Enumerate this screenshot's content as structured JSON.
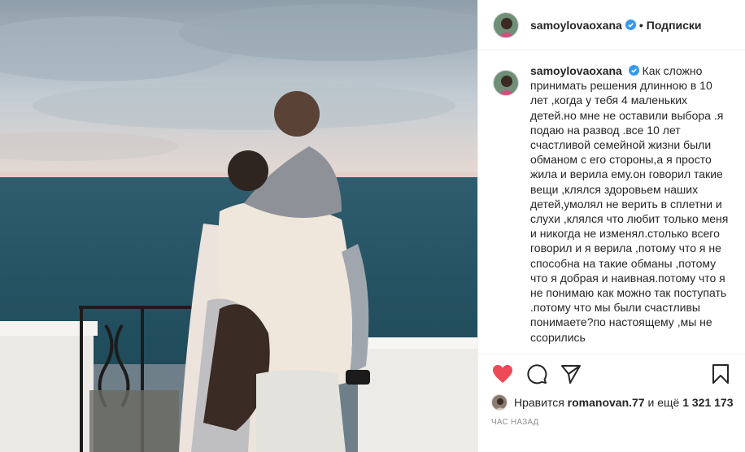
{
  "post": {
    "username": "samoylovaoxana",
    "separator": "•",
    "follow_label": "Подписки",
    "caption_text": "Как сложно принимать решения длинною в 10 лет ,когда у тебя 4 маленьких детей.но мне не оставили выбора .я подаю на развод .все 10 лет счастливой семейной жизни были обманом с его стороны,а я просто жила и верила ему.он говорил такие вещи ,клялся здоровьем наших детей,умолял не верить в сплетни и слухи ,клялся что любит только меня и никогда не изменял.столько всего говорил и я верила ,потому что я не способна на такие обманы ,потому что я добрая и наивная.потому что я не понимаю как можно так поступать .потому что мы были счастливы понимаете?по настоящему ,мы не ссорились",
    "likes_prefix": "Нравится",
    "likes_user": "romanovan.77",
    "likes_middle": "и ещё",
    "likes_count": "1 321 173",
    "timestamp": "час назад"
  },
  "icons": {
    "like": "heart-icon-filled",
    "comment": "comment-icon",
    "share": "share-icon",
    "save": "bookmark-icon",
    "verified": "verified-badge-icon"
  },
  "colors": {
    "like_red": "#ed4956",
    "verified_blue": "#3897f0",
    "text": "#262626",
    "muted": "#8e8e8e"
  }
}
